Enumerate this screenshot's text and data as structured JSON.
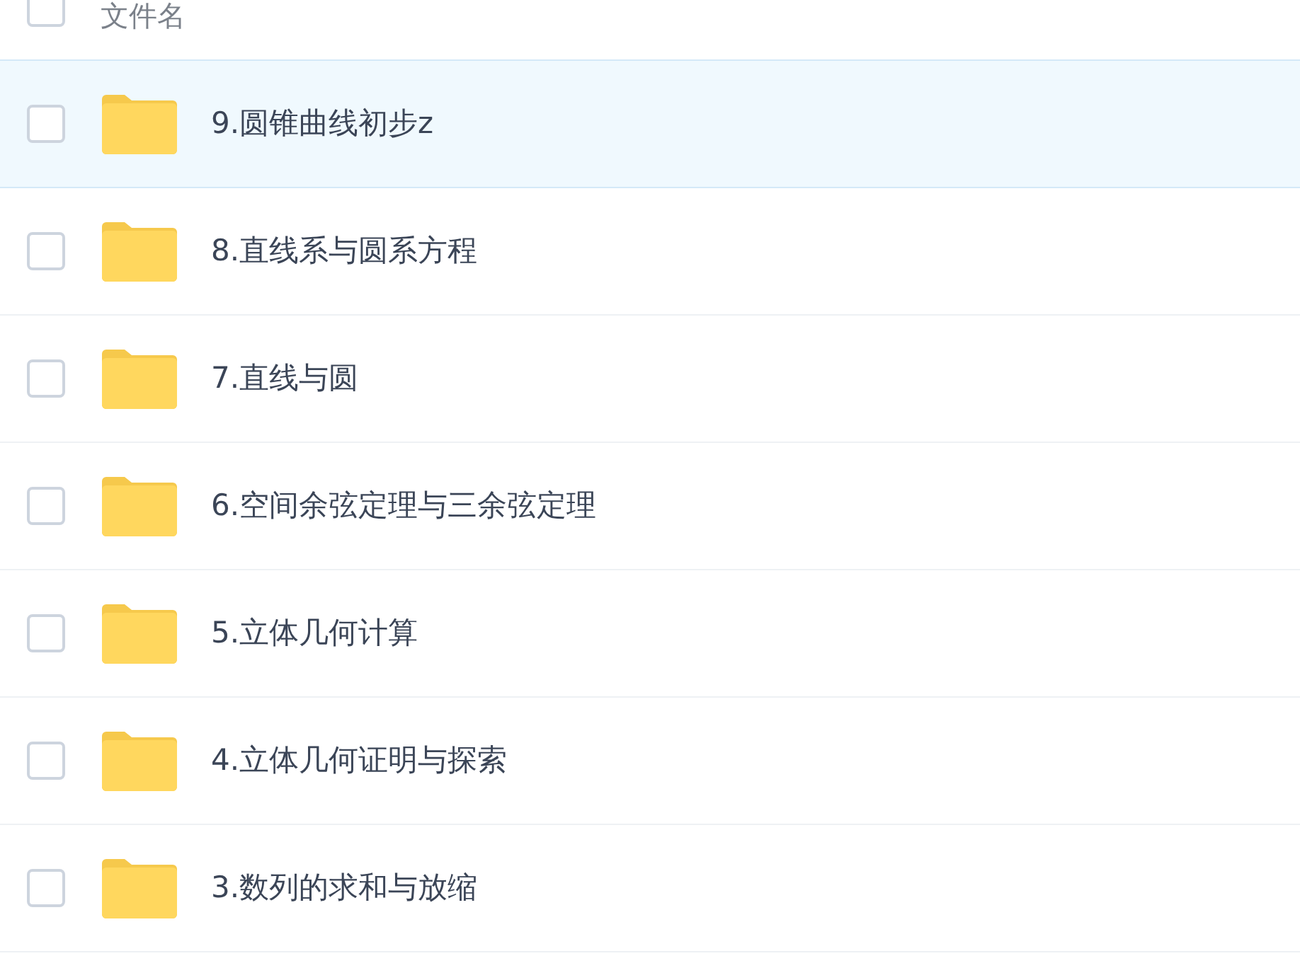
{
  "header": {
    "checked": false,
    "label": "文件名"
  },
  "rows": [
    {
      "name": "9.圆锥曲线初步z",
      "selected": true,
      "checked": false
    },
    {
      "name": "8.直线系与圆系方程",
      "selected": false,
      "checked": false
    },
    {
      "name": "7.直线与圆",
      "selected": false,
      "checked": false
    },
    {
      "name": "6.空间余弦定理与三余弦定理",
      "selected": false,
      "checked": false
    },
    {
      "name": "5.立体几何计算",
      "selected": false,
      "checked": false
    },
    {
      "name": "4.立体几何证明与探索",
      "selected": false,
      "checked": false
    },
    {
      "name": "3.数列的求和与放缩",
      "selected": false,
      "checked": false
    }
  ]
}
